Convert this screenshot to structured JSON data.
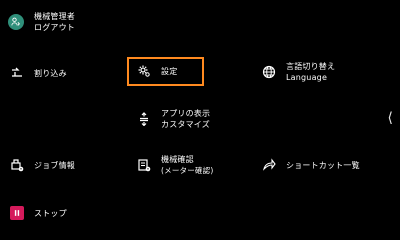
{
  "admin": {
    "title": "機械管理者",
    "logout": "ログアウト"
  },
  "menu": {
    "interrupt": "割り込み",
    "settings": "設定",
    "language_switch": "言語切り替え",
    "language_en": "Language",
    "app_display_customize_line1": "アプリの表示",
    "app_display_customize_line2": "カスタマイズ",
    "job_info": "ジョブ情報",
    "machine_check_line1": "機械確認",
    "machine_check_line2": "(メーター確認)",
    "shortcut_list": "ショートカット一覧",
    "stop": "ストップ"
  },
  "colors": {
    "background": "#000000",
    "text": "#ffffff",
    "settings_highlight": "#ff8a1f",
    "stop_badge": "#d51a5b",
    "avatar": "#2f8f7a"
  },
  "icons": {
    "admin": "admin-avatar-icon",
    "interrupt": "interrupt-icon",
    "settings": "settings-icon",
    "language": "globe-icon",
    "customize": "customize-icon",
    "job_info": "job-info-icon",
    "machine_check": "machine-check-icon",
    "shortcut": "shortcut-icon",
    "stop": "stop-icon",
    "panel_toggle": "chevron-left-icon"
  }
}
